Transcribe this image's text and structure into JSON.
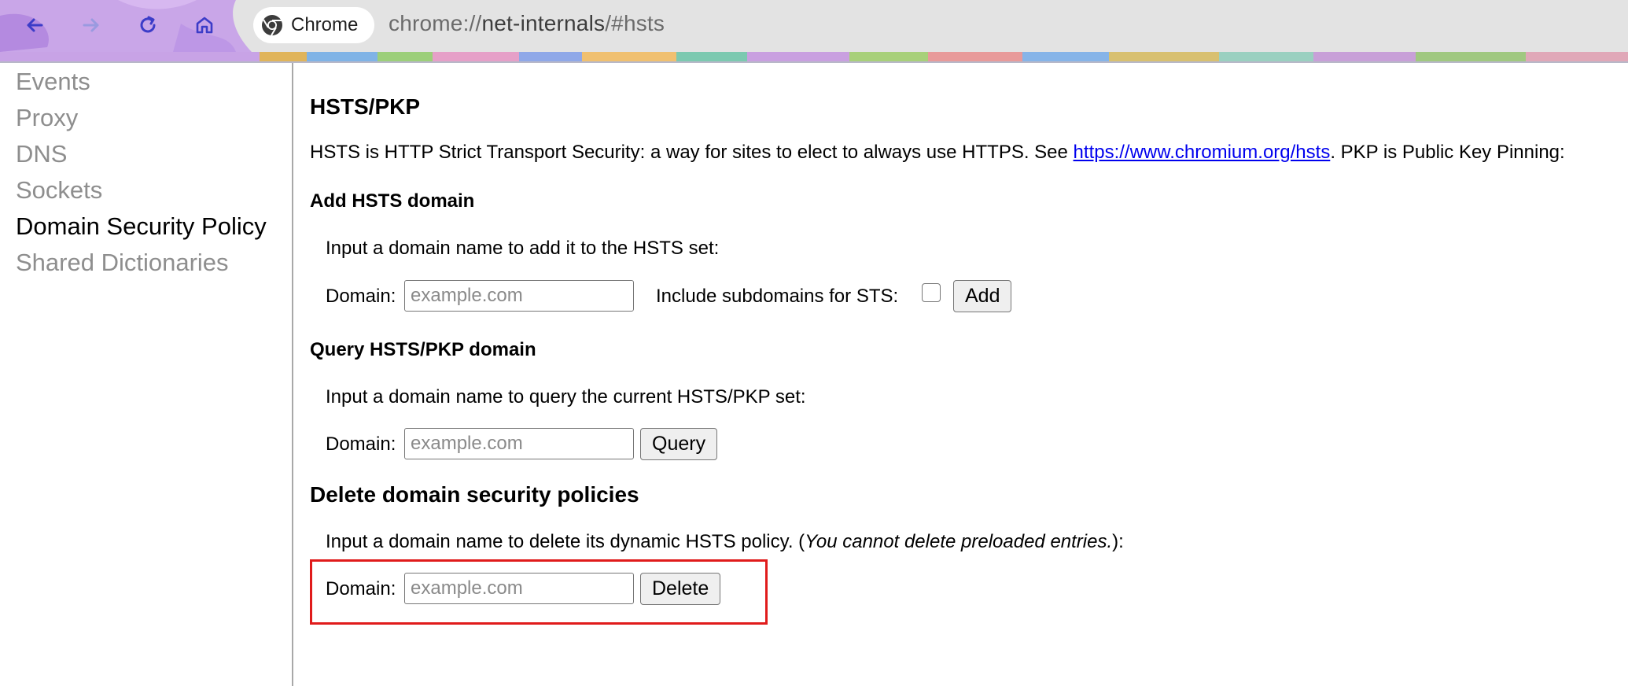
{
  "browser": {
    "chip_label": "Chrome",
    "url_scheme": "chrome://",
    "url_host": "net-internals",
    "url_path": "/#hsts",
    "icons": [
      "back-arrow-icon",
      "forward-arrow-icon",
      "reload-icon",
      "home-icon",
      "chrome-logo-icon"
    ],
    "accent_color": "#3c3cc8"
  },
  "sidebar": {
    "items": [
      {
        "label": "Events",
        "active": false
      },
      {
        "label": "Proxy",
        "active": false
      },
      {
        "label": "DNS",
        "active": false
      },
      {
        "label": "Sockets",
        "active": false
      },
      {
        "label": "Domain Security Policy",
        "active": true
      },
      {
        "label": "Shared Dictionaries",
        "active": false
      }
    ]
  },
  "main": {
    "title": "HSTS/PKP",
    "intro_before_link": "HSTS is HTTP Strict Transport Security: a way for sites to elect to always use HTTPS. See ",
    "intro_link": "https://www.chromium.org/hsts",
    "intro_after_link": ". PKP is Public Key Pinning:",
    "add": {
      "heading": "Add HSTS domain",
      "description": "Input a domain name to add it to the HSTS set:",
      "domain_label": "Domain:",
      "placeholder": "example.com",
      "subdomains_label": "Include subdomains for STS:",
      "button": "Add"
    },
    "query": {
      "heading": "Query HSTS/PKP domain",
      "description": "Input a domain name to query the current HSTS/PKP set:",
      "domain_label": "Domain:",
      "placeholder": "example.com",
      "button": "Query"
    },
    "delete": {
      "heading": "Delete domain security policies",
      "description_before": "Input a domain name to delete its dynamic HSTS policy. (",
      "description_italic": "You cannot delete preloaded entries.",
      "description_after": "):",
      "domain_label": "Domain:",
      "placeholder": "example.com",
      "button": "Delete",
      "highlight_color": "#e01b1b"
    }
  }
}
